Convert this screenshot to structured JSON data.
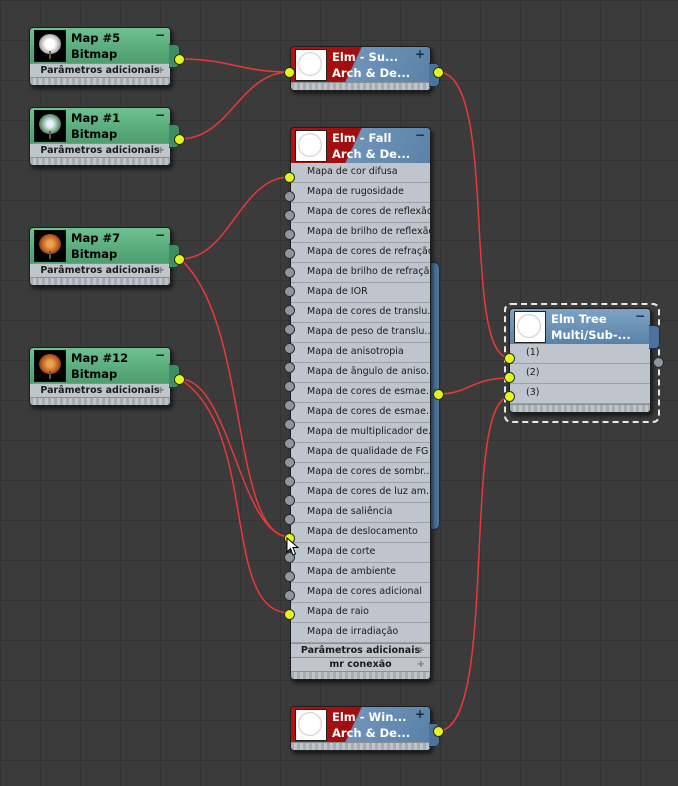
{
  "bitmap_nodes": [
    {
      "title": "Map #5",
      "type": "Bitmap",
      "extra": "Parâmetros adicionais",
      "collapse": "−",
      "thumbnail": "white-tree"
    },
    {
      "title": "Map #1",
      "type": "Bitmap",
      "extra": "Parâmetros adicionais",
      "collapse": "−",
      "thumbnail": "green-tree"
    },
    {
      "title": "Map #7",
      "type": "Bitmap",
      "extra": "Parâmetros adicionais",
      "collapse": "−",
      "thumbnail": "orange-tree"
    },
    {
      "title": "Map #12",
      "type": "Bitmap",
      "extra": "Parâmetros adicionais",
      "collapse": "−",
      "thumbnail": "orange-tree"
    }
  ],
  "material_nodes": {
    "elm_su": {
      "title": "Elm - Su...",
      "type": "Arch & De...",
      "expand": "+"
    },
    "elm_fall": {
      "title": "Elm - Fall",
      "type": "Arch & De...",
      "expand": "−",
      "slots": [
        "Mapa de cor difusa",
        "Mapa de rugosidade",
        "Mapa de cores de reflexão",
        "Mapa de brilho de reflexão",
        "Mapa de cores de refração",
        "Mapa de brilho de refração",
        "Mapa de IOR",
        "Mapa de cores de translu...",
        "Mapa de peso de translu...",
        "Mapa de anisotropia",
        "Mapa de ângulo de aniso...",
        "Mapa de cores de esmae...",
        "Mapa de cores de esmae...",
        "Mapa de multiplicador de...",
        "Mapa de qualidade de FG",
        "Mapa de cores de sombr...",
        "Mapa de cores de luz am...",
        "Mapa de saliência",
        "Mapa de deslocamento",
        "Mapa de corte",
        "Mapa de ambiente",
        "Mapa de cores adicional",
        "Mapa de raio",
        "Mapa de irradiação"
      ],
      "extra": "Parâmetros adicionais",
      "extra2": "mr conexão"
    },
    "elm_win": {
      "title": "Elm - Win...",
      "type": "Arch & De...",
      "expand": "+"
    },
    "elm_tree": {
      "title": "Elm Tree",
      "type": "Multi/Sub-...",
      "collapse": "−",
      "slots": [
        "(1)",
        "(2)",
        "(3)"
      ]
    }
  },
  "colors": {
    "wire": "#e8383a",
    "socket_active": "#e4f51c",
    "socket_inactive": "#8e979f",
    "bitmap_header": "#5fae80",
    "material_header": "#6a92b9",
    "red_header": "#b31212"
  }
}
